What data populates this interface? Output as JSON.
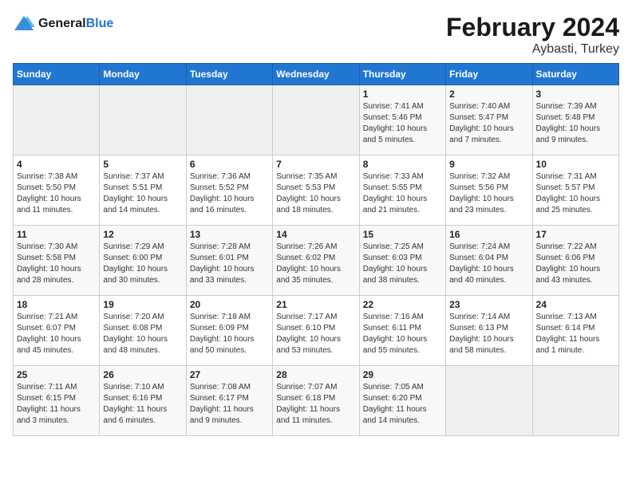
{
  "header": {
    "logo_line1": "General",
    "logo_line2": "Blue",
    "month": "February 2024",
    "location": "Aybasti, Turkey"
  },
  "weekdays": [
    "Sunday",
    "Monday",
    "Tuesday",
    "Wednesday",
    "Thursday",
    "Friday",
    "Saturday"
  ],
  "weeks": [
    [
      {
        "day": "",
        "info": ""
      },
      {
        "day": "",
        "info": ""
      },
      {
        "day": "",
        "info": ""
      },
      {
        "day": "",
        "info": ""
      },
      {
        "day": "1",
        "info": "Sunrise: 7:41 AM\nSunset: 5:46 PM\nDaylight: 10 hours\nand 5 minutes."
      },
      {
        "day": "2",
        "info": "Sunrise: 7:40 AM\nSunset: 5:47 PM\nDaylight: 10 hours\nand 7 minutes."
      },
      {
        "day": "3",
        "info": "Sunrise: 7:39 AM\nSunset: 5:48 PM\nDaylight: 10 hours\nand 9 minutes."
      }
    ],
    [
      {
        "day": "4",
        "info": "Sunrise: 7:38 AM\nSunset: 5:50 PM\nDaylight: 10 hours\nand 11 minutes."
      },
      {
        "day": "5",
        "info": "Sunrise: 7:37 AM\nSunset: 5:51 PM\nDaylight: 10 hours\nand 14 minutes."
      },
      {
        "day": "6",
        "info": "Sunrise: 7:36 AM\nSunset: 5:52 PM\nDaylight: 10 hours\nand 16 minutes."
      },
      {
        "day": "7",
        "info": "Sunrise: 7:35 AM\nSunset: 5:53 PM\nDaylight: 10 hours\nand 18 minutes."
      },
      {
        "day": "8",
        "info": "Sunrise: 7:33 AM\nSunset: 5:55 PM\nDaylight: 10 hours\nand 21 minutes."
      },
      {
        "day": "9",
        "info": "Sunrise: 7:32 AM\nSunset: 5:56 PM\nDaylight: 10 hours\nand 23 minutes."
      },
      {
        "day": "10",
        "info": "Sunrise: 7:31 AM\nSunset: 5:57 PM\nDaylight: 10 hours\nand 25 minutes."
      }
    ],
    [
      {
        "day": "11",
        "info": "Sunrise: 7:30 AM\nSunset: 5:58 PM\nDaylight: 10 hours\nand 28 minutes."
      },
      {
        "day": "12",
        "info": "Sunrise: 7:29 AM\nSunset: 6:00 PM\nDaylight: 10 hours\nand 30 minutes."
      },
      {
        "day": "13",
        "info": "Sunrise: 7:28 AM\nSunset: 6:01 PM\nDaylight: 10 hours\nand 33 minutes."
      },
      {
        "day": "14",
        "info": "Sunrise: 7:26 AM\nSunset: 6:02 PM\nDaylight: 10 hours\nand 35 minutes."
      },
      {
        "day": "15",
        "info": "Sunrise: 7:25 AM\nSunset: 6:03 PM\nDaylight: 10 hours\nand 38 minutes."
      },
      {
        "day": "16",
        "info": "Sunrise: 7:24 AM\nSunset: 6:04 PM\nDaylight: 10 hours\nand 40 minutes."
      },
      {
        "day": "17",
        "info": "Sunrise: 7:22 AM\nSunset: 6:06 PM\nDaylight: 10 hours\nand 43 minutes."
      }
    ],
    [
      {
        "day": "18",
        "info": "Sunrise: 7:21 AM\nSunset: 6:07 PM\nDaylight: 10 hours\nand 45 minutes."
      },
      {
        "day": "19",
        "info": "Sunrise: 7:20 AM\nSunset: 6:08 PM\nDaylight: 10 hours\nand 48 minutes."
      },
      {
        "day": "20",
        "info": "Sunrise: 7:18 AM\nSunset: 6:09 PM\nDaylight: 10 hours\nand 50 minutes."
      },
      {
        "day": "21",
        "info": "Sunrise: 7:17 AM\nSunset: 6:10 PM\nDaylight: 10 hours\nand 53 minutes."
      },
      {
        "day": "22",
        "info": "Sunrise: 7:16 AM\nSunset: 6:11 PM\nDaylight: 10 hours\nand 55 minutes."
      },
      {
        "day": "23",
        "info": "Sunrise: 7:14 AM\nSunset: 6:13 PM\nDaylight: 10 hours\nand 58 minutes."
      },
      {
        "day": "24",
        "info": "Sunrise: 7:13 AM\nSunset: 6:14 PM\nDaylight: 11 hours\nand 1 minute."
      }
    ],
    [
      {
        "day": "25",
        "info": "Sunrise: 7:11 AM\nSunset: 6:15 PM\nDaylight: 11 hours\nand 3 minutes."
      },
      {
        "day": "26",
        "info": "Sunrise: 7:10 AM\nSunset: 6:16 PM\nDaylight: 11 hours\nand 6 minutes."
      },
      {
        "day": "27",
        "info": "Sunrise: 7:08 AM\nSunset: 6:17 PM\nDaylight: 11 hours\nand 9 minutes."
      },
      {
        "day": "28",
        "info": "Sunrise: 7:07 AM\nSunset: 6:18 PM\nDaylight: 11 hours\nand 11 minutes."
      },
      {
        "day": "29",
        "info": "Sunrise: 7:05 AM\nSunset: 6:20 PM\nDaylight: 11 hours\nand 14 minutes."
      },
      {
        "day": "",
        "info": ""
      },
      {
        "day": "",
        "info": ""
      }
    ]
  ]
}
